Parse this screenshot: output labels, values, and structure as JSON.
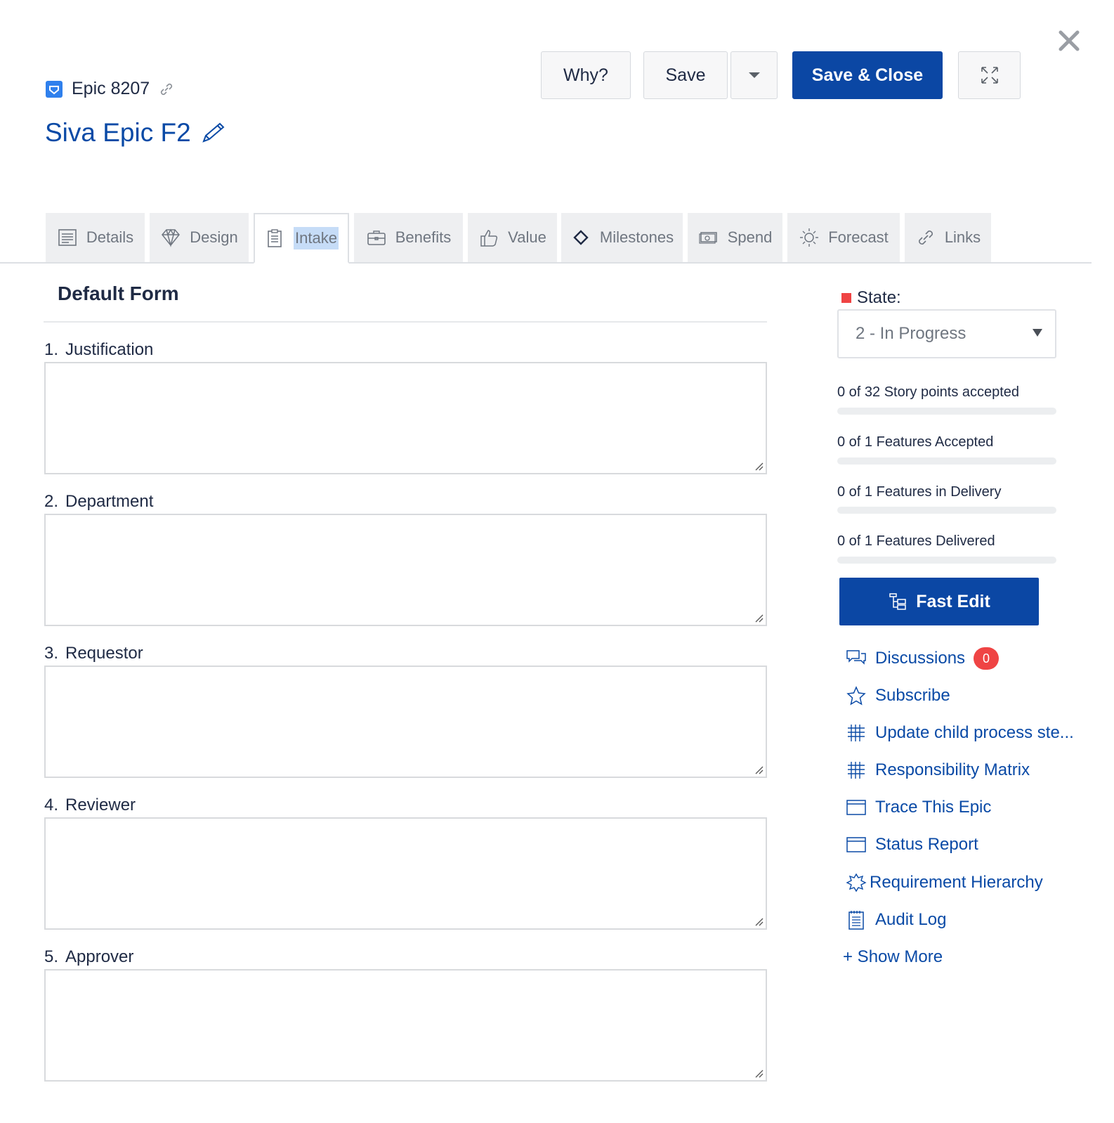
{
  "header": {
    "epic_id": "Epic 8207",
    "title": "Siva Epic F2"
  },
  "toolbar": {
    "why_label": "Why?",
    "save_label": "Save",
    "save_close_label": "Save & Close"
  },
  "tabs": [
    {
      "label": "Details",
      "icon": "document-icon"
    },
    {
      "label": "Design",
      "icon": "diamond-gem-icon"
    },
    {
      "label": "Intake",
      "icon": "clipboard-icon",
      "active": true
    },
    {
      "label": "Benefits",
      "icon": "briefcase-icon"
    },
    {
      "label": "Value",
      "icon": "thumbs-up-icon"
    },
    {
      "label": "Milestones",
      "icon": "milestone-diamond-icon"
    },
    {
      "label": "Spend",
      "icon": "money-icon"
    },
    {
      "label": "Forecast",
      "icon": "sun-icon"
    },
    {
      "label": "Links",
      "icon": "link-icon"
    }
  ],
  "form": {
    "title": "Default Form",
    "fields": [
      {
        "num": "1.",
        "label": "Justification",
        "value": ""
      },
      {
        "num": "2.",
        "label": "Department",
        "value": ""
      },
      {
        "num": "3.",
        "label": "Requestor",
        "value": ""
      },
      {
        "num": "4.",
        "label": "Reviewer",
        "value": ""
      },
      {
        "num": "5.",
        "label": "Approver",
        "value": ""
      }
    ]
  },
  "sidebar": {
    "state_label": "State:",
    "state_value": "2 - In Progress",
    "state_color": "#ef4444",
    "progress": [
      {
        "label": "0 of 32 Story points accepted",
        "fraction": 0
      },
      {
        "label": "0 of 1 Features Accepted",
        "fraction": 0
      },
      {
        "label": "0 of 1 Features in Delivery",
        "fraction": 0
      },
      {
        "label": "0 of 1 Features Delivered",
        "fraction": 0
      }
    ],
    "fast_edit_label": "Fast Edit",
    "actions": [
      {
        "label": "Discussions",
        "icon": "discussions-icon",
        "count": "0"
      },
      {
        "label": "Subscribe",
        "icon": "star-icon"
      },
      {
        "label": "Update child process ste...",
        "icon": "grid-icon"
      },
      {
        "label": "Responsibility Matrix",
        "icon": "grid-icon"
      },
      {
        "label": "Trace This Epic",
        "icon": "window-icon"
      },
      {
        "label": "Status Report",
        "icon": "window-icon"
      },
      {
        "label": "Requirement Hierarchy",
        "icon": "hierarchy-icon"
      },
      {
        "label": "Audit Log",
        "icon": "notepad-icon"
      }
    ],
    "show_more_label": "+ Show More"
  },
  "colors": {
    "primary": "#0b47a4",
    "link": "#0a4aa6",
    "badge_red": "#ef4444"
  }
}
